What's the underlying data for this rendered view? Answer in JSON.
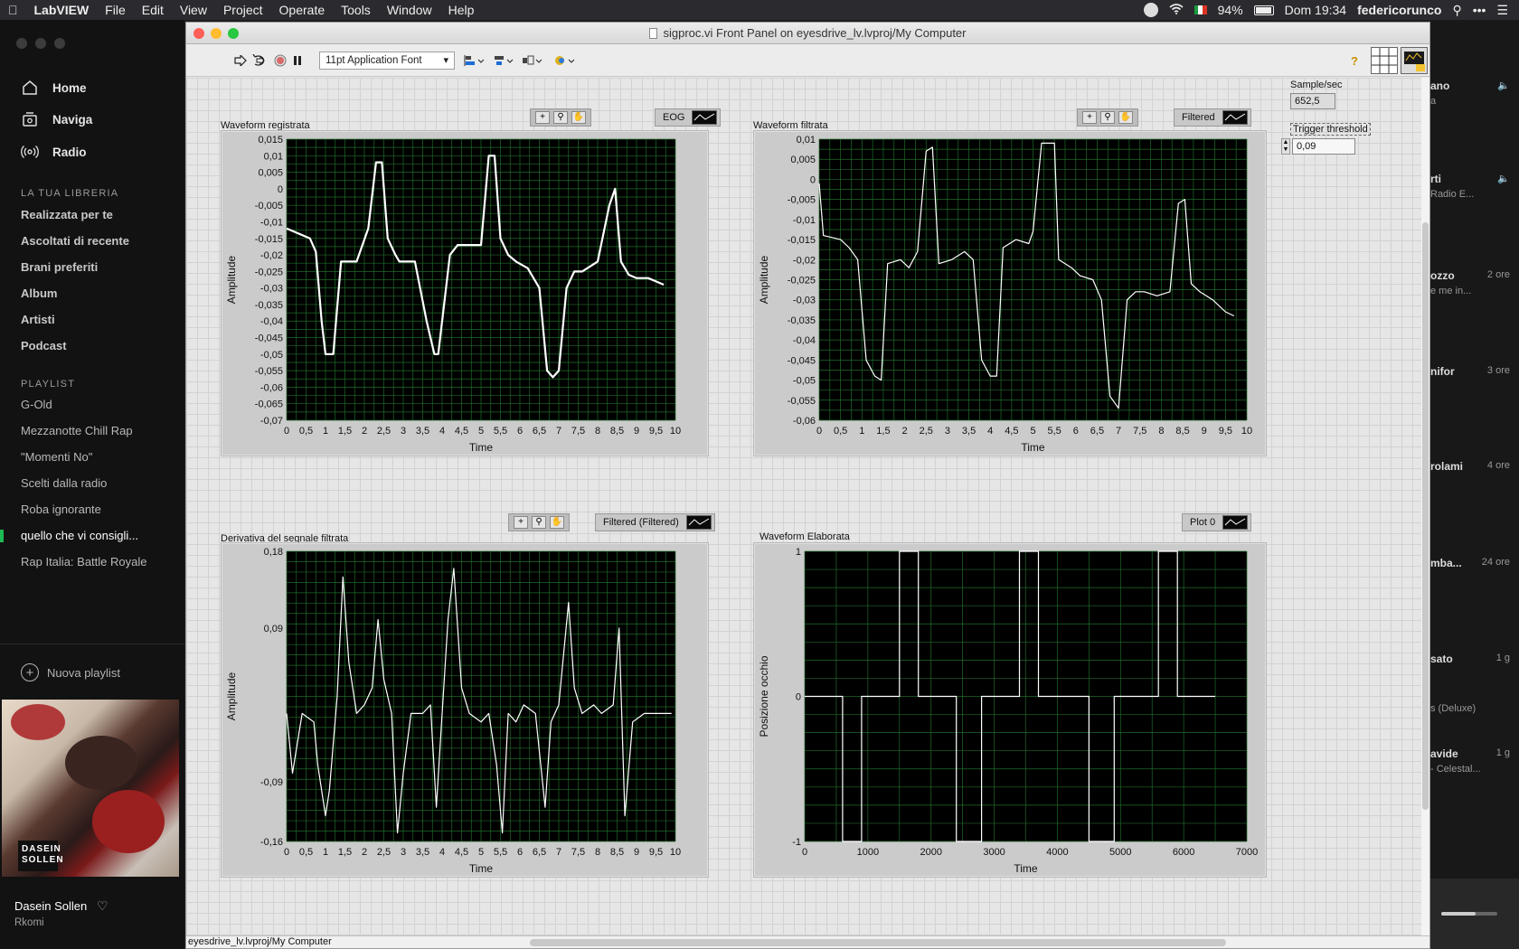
{
  "menubar": {
    "app": "LabVIEW",
    "items": [
      "File",
      "Edit",
      "View",
      "Project",
      "Operate",
      "Tools",
      "Window",
      "Help"
    ],
    "battery": "94%",
    "clock": "Dom 19:34",
    "user": "federicorunco"
  },
  "spotify": {
    "nav": [
      {
        "label": "Home",
        "icon": "home-icon"
      },
      {
        "label": "Naviga",
        "icon": "browse-icon"
      },
      {
        "label": "Radio",
        "icon": "radio-icon"
      }
    ],
    "library_heading": "LA TUA LIBRERIA",
    "library": [
      "Realizzata per te",
      "Ascoltati di recente",
      "Brani preferiti",
      "Album",
      "Artisti",
      "Podcast"
    ],
    "playlist_heading": "PLAYLIST",
    "playlists": [
      "G-Old",
      "Mezzanotte Chill Rap",
      "\"Momenti No\"",
      "Scelti dalla radio",
      "Roba ignorante",
      "quello che vi consigli...",
      "Rap Italia: Battle Royale"
    ],
    "active_playlist": 5,
    "new_playlist": "Nuova playlist",
    "cover_text": "DASEIN SOLLEN",
    "now_playing_title": "Dasein Sollen",
    "now_playing_artist": "Rkomi",
    "right_items": [
      {
        "title": "ano",
        "sub": "a",
        "time": ""
      },
      {
        "title": "rti",
        "sub": "Radio E...",
        "time": ""
      },
      {
        "title": "ozzo",
        "sub": "e me in...",
        "time": "2 ore"
      },
      {
        "title": "nifor",
        "sub": "",
        "time": "3 ore"
      },
      {
        "title": "rolami",
        "sub": "",
        "time": "4 ore"
      },
      {
        "title": "mba...",
        "sub": "",
        "time": "24 ore"
      },
      {
        "title": "sato",
        "sub": "s (Deluxe)",
        "time": "1 g"
      },
      {
        "title": "avide",
        "sub": "- Celestal...",
        "time": "1 g"
      }
    ]
  },
  "window": {
    "title": "sigproc.vi Front Panel on eyesdrive_lv.lvproj/My Computer",
    "font_selector": "11pt Application Font",
    "status_path": "eyesdrive_lv.lvproj/My Computer"
  },
  "controls": {
    "sample_label": "Sample/sec",
    "sample_value": "652,5",
    "trigger_label": "Trigger threshold",
    "trigger_value": "0,09"
  },
  "colors": {
    "plot_bg": "#000000",
    "grid": "#1f6b2a",
    "trace": "#ffffff"
  },
  "chart_data": [
    {
      "type": "line",
      "title": "Waveform registrata",
      "legend": "EOG",
      "xlabel": "Time",
      "ylabel": "Amplitude",
      "xlim": [
        0,
        10
      ],
      "ylim": [
        -0.07,
        0.015
      ],
      "xticks": [
        "0",
        "0,5",
        "1",
        "1,5",
        "2",
        "2,5",
        "3",
        "3,5",
        "4",
        "4,5",
        "5",
        "5,5",
        "6",
        "6,5",
        "7",
        "7,5",
        "8",
        "8,5",
        "9",
        "9,5",
        "10"
      ],
      "yticks": [
        "0,015",
        "0,01",
        "0,005",
        "0",
        "-0,005",
        "-0,01",
        "-0,015",
        "-0,02",
        "-0,025",
        "-0,03",
        "-0,035",
        "-0,04",
        "-0,045",
        "-0,05",
        "-0,055",
        "-0,06",
        "-0,065",
        "-0,07"
      ],
      "series": [
        {
          "x": [
            0,
            0.6,
            0.75,
            0.9,
            1.0,
            1.2,
            1.4,
            1.5,
            1.8,
            2.1,
            2.3,
            2.45,
            2.6,
            2.8,
            2.9,
            3.3,
            3.6,
            3.8,
            3.9,
            4.2,
            4.4,
            4.6,
            5.0,
            5.2,
            5.35,
            5.5,
            5.7,
            5.9,
            6.2,
            6.5,
            6.7,
            6.85,
            7.0,
            7.2,
            7.4,
            7.6,
            8.0,
            8.3,
            8.45,
            8.6,
            8.8,
            9.0,
            9.3,
            9.7
          ],
          "y": [
            -0.012,
            -0.015,
            -0.019,
            -0.04,
            -0.05,
            -0.05,
            -0.022,
            -0.022,
            -0.022,
            -0.012,
            0.008,
            0.008,
            -0.015,
            -0.02,
            -0.022,
            -0.022,
            -0.04,
            -0.05,
            -0.05,
            -0.02,
            -0.017,
            -0.017,
            -0.017,
            0.01,
            0.01,
            -0.015,
            -0.02,
            -0.022,
            -0.024,
            -0.03,
            -0.055,
            -0.057,
            -0.055,
            -0.03,
            -0.025,
            -0.025,
            -0.022,
            -0.005,
            0.0,
            -0.022,
            -0.026,
            -0.027,
            -0.027,
            -0.029
          ]
        }
      ]
    },
    {
      "type": "line",
      "title": "Waveform filtrata",
      "legend": "Filtered",
      "xlabel": "Time",
      "ylabel": "Amplitude",
      "xlim": [
        0,
        10
      ],
      "ylim": [
        -0.06,
        0.01
      ],
      "xticks": [
        "0",
        "0,5",
        "1",
        "1,5",
        "2",
        "2,5",
        "3",
        "3,5",
        "4",
        "4,5",
        "5",
        "5,5",
        "6",
        "6,5",
        "7",
        "7,5",
        "8",
        "8,5",
        "9",
        "9,5",
        "10"
      ],
      "yticks": [
        "0,01",
        "0,005",
        "0",
        "-0,005",
        "-0,01",
        "-0,015",
        "-0,02",
        "-0,025",
        "-0,03",
        "-0,035",
        "-0,04",
        "-0,045",
        "-0,05",
        "-0,055",
        "-0,06"
      ],
      "series": [
        {
          "x": [
            0,
            0.1,
            0.5,
            0.7,
            0.9,
            1.1,
            1.3,
            1.45,
            1.6,
            1.9,
            2.1,
            2.3,
            2.5,
            2.65,
            2.8,
            3.1,
            3.4,
            3.6,
            3.8,
            4.0,
            4.15,
            4.3,
            4.6,
            4.9,
            5.0,
            5.2,
            5.5,
            5.6,
            5.9,
            6.1,
            6.4,
            6.6,
            6.8,
            7.0,
            7.2,
            7.4,
            7.6,
            7.9,
            8.2,
            8.4,
            8.55,
            8.7,
            8.9,
            9.2,
            9.5,
            9.7
          ],
          "y": [
            -0.001,
            -0.014,
            -0.015,
            -0.017,
            -0.02,
            -0.045,
            -0.049,
            -0.05,
            -0.021,
            -0.02,
            -0.022,
            -0.018,
            0.007,
            0.008,
            -0.021,
            -0.02,
            -0.018,
            -0.02,
            -0.045,
            -0.049,
            -0.049,
            -0.017,
            -0.015,
            -0.016,
            -0.013,
            0.009,
            0.009,
            -0.02,
            -0.022,
            -0.024,
            -0.025,
            -0.03,
            -0.054,
            -0.057,
            -0.03,
            -0.028,
            -0.028,
            -0.029,
            -0.028,
            -0.006,
            -0.005,
            -0.026,
            -0.028,
            -0.03,
            -0.033,
            -0.034
          ]
        }
      ]
    },
    {
      "type": "line",
      "title": "Derivativa del segnale filtrata",
      "legend": "Filtered (Filtered)",
      "xlabel": "Time",
      "ylabel": "Amplitude",
      "xlim": [
        0,
        10
      ],
      "ylim": [
        -0.16,
        0.18
      ],
      "xticks": [
        "0",
        "0,5",
        "1",
        "1,5",
        "2",
        "2,5",
        "3",
        "3,5",
        "4",
        "4,5",
        "5",
        "5,5",
        "6",
        "6,5",
        "7",
        "7,5",
        "8",
        "8,5",
        "9",
        "9,5",
        "10"
      ],
      "yticks": [
        "0,18",
        "0,09",
        "-0,09",
        "-0,16"
      ],
      "series": [
        {
          "x": [
            0,
            0.15,
            0.4,
            0.7,
            0.8,
            1.0,
            1.1,
            1.3,
            1.45,
            1.6,
            1.8,
            2.0,
            2.2,
            2.35,
            2.5,
            2.7,
            2.85,
            3.0,
            3.2,
            3.5,
            3.7,
            3.85,
            4.0,
            4.15,
            4.3,
            4.5,
            4.7,
            5.0,
            5.2,
            5.4,
            5.55,
            5.7,
            5.9,
            6.1,
            6.4,
            6.65,
            6.8,
            7.0,
            7.25,
            7.4,
            7.6,
            7.9,
            8.1,
            8.4,
            8.55,
            8.7,
            8.9,
            9.2,
            9.6,
            9.9
          ],
          "y": [
            -0.01,
            -0.08,
            -0.01,
            -0.02,
            -0.07,
            -0.13,
            -0.1,
            0.01,
            0.15,
            0.05,
            -0.01,
            0.0,
            0.02,
            0.1,
            0.03,
            -0.01,
            -0.15,
            -0.08,
            -0.01,
            -0.01,
            0.0,
            -0.12,
            -0.01,
            0.1,
            0.16,
            0.02,
            -0.01,
            -0.02,
            -0.01,
            -0.07,
            -0.15,
            -0.01,
            -0.02,
            0.0,
            -0.01,
            -0.12,
            -0.02,
            0.0,
            0.12,
            0.02,
            -0.01,
            0.0,
            -0.01,
            0.0,
            0.09,
            -0.13,
            -0.02,
            -0.01,
            -0.01,
            -0.01
          ]
        }
      ]
    },
    {
      "type": "line",
      "title": "Waveform Elaborata",
      "legend": "Plot 0",
      "xlabel": "Time",
      "ylabel": "Posizione occhio",
      "xlim": [
        0,
        7000
      ],
      "ylim": [
        -1,
        1
      ],
      "xticks": [
        "0",
        "1000",
        "2000",
        "3000",
        "4000",
        "5000",
        "6000",
        "7000"
      ],
      "yticks": [
        "1",
        "0",
        "-1"
      ],
      "series": [
        {
          "x": [
            0,
            600,
            600,
            900,
            900,
            1500,
            1500,
            1800,
            1800,
            2400,
            2400,
            2800,
            2800,
            3400,
            3400,
            3700,
            3700,
            4500,
            4500,
            4900,
            4900,
            5600,
            5600,
            5900,
            5900,
            6500
          ],
          "y": [
            0,
            0,
            -1,
            -1,
            0,
            0,
            1,
            1,
            0,
            0,
            -1,
            -1,
            0,
            0,
            1,
            1,
            0,
            0,
            -1,
            -1,
            0,
            0,
            1,
            1,
            0,
            0
          ]
        }
      ]
    }
  ]
}
